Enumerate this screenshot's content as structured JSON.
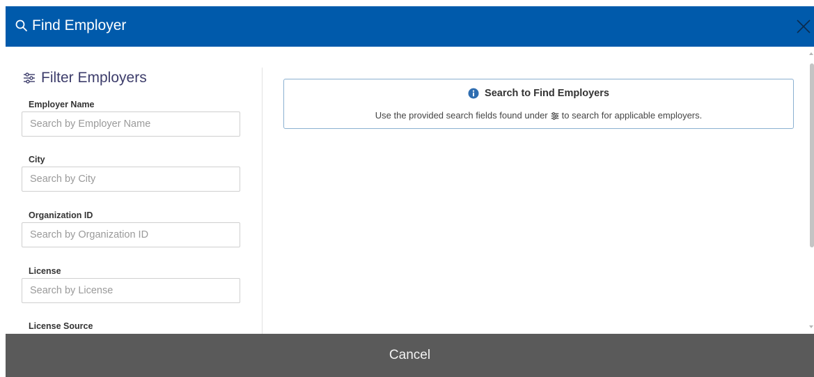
{
  "header": {
    "title": "Find Employer",
    "search_icon": "search-icon",
    "close_icon": "close-icon",
    "background_color": "#005aab"
  },
  "sidebar": {
    "title": "Filter Employers",
    "title_icon": "filter-sliders-icon",
    "fields": [
      {
        "label": "Employer Name",
        "placeholder": "Search by Employer Name",
        "value": ""
      },
      {
        "label": "City",
        "placeholder": "Search by City",
        "value": ""
      },
      {
        "label": "Organization ID",
        "placeholder": "Search by Organization ID",
        "value": ""
      },
      {
        "label": "License",
        "placeholder": "Search by License",
        "value": ""
      },
      {
        "label": "License Source"
      }
    ]
  },
  "info": {
    "icon": "info-icon",
    "heading": "Search to Find Employers",
    "text_before": "Use the provided search fields found under",
    "inline_icon": "filter-sliders-icon",
    "text_after": "to search for applicable employers."
  },
  "footer": {
    "cancel_label": "Cancel",
    "background_color": "#5a5a5a"
  }
}
